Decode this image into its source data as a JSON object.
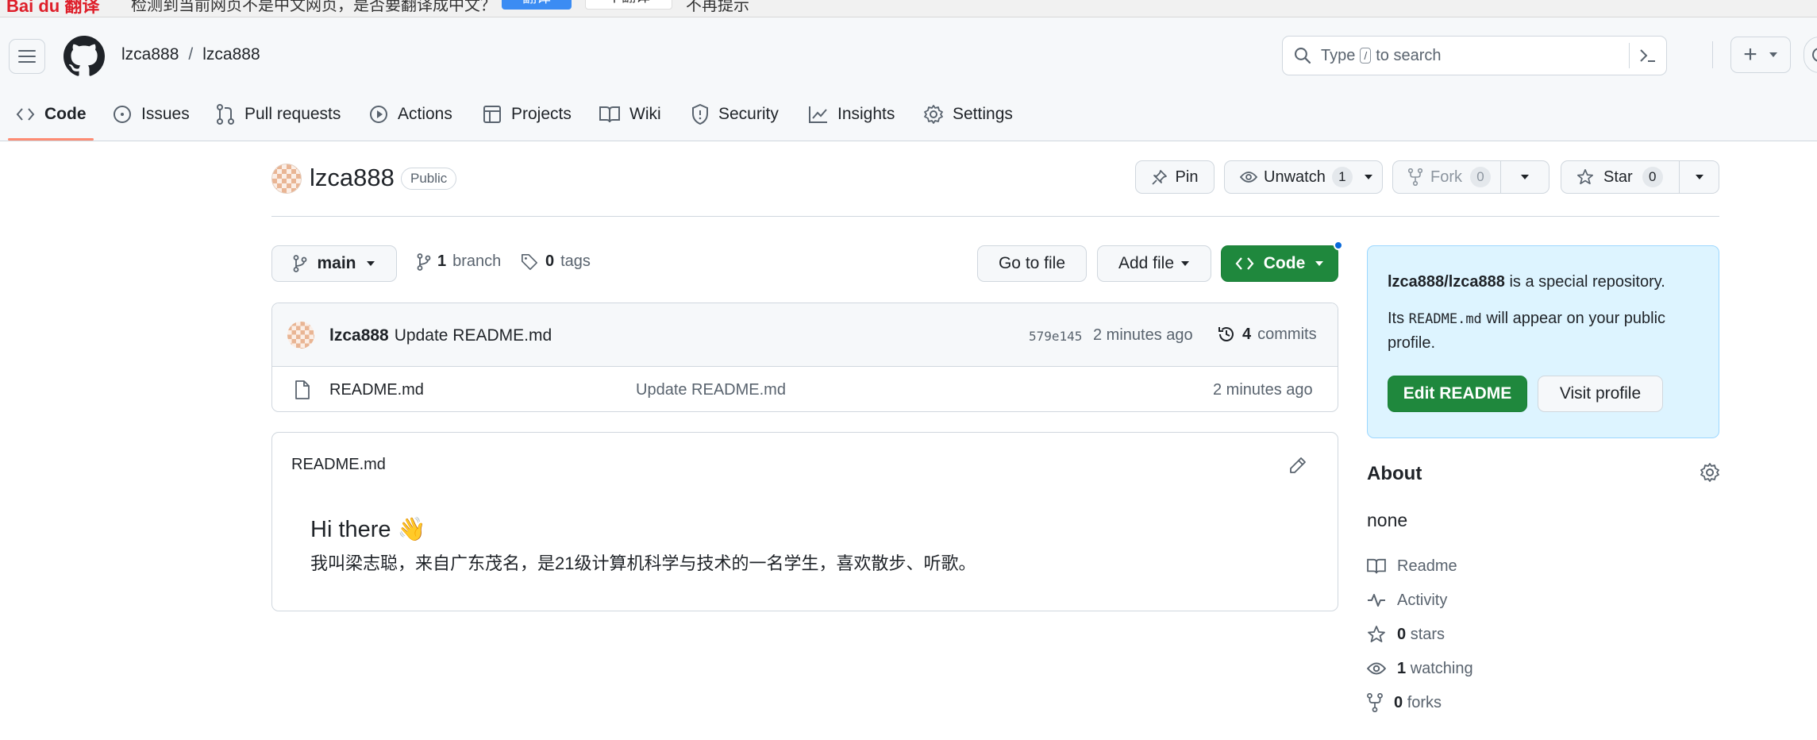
{
  "translate_bar": {
    "logo": "Bai du 翻译",
    "message": "检测到当前网页不是中文网页，是否要翻译成中文？",
    "translate_button": "翻译",
    "no_translate_button": "不翻译",
    "never_prompt": "不再提示"
  },
  "header": {
    "owner": "lzca888",
    "separator": "/",
    "repo": "lzca888",
    "search_prefix": "Type",
    "search_key": "/",
    "search_suffix": "to search",
    "plus": "+"
  },
  "tabs": [
    {
      "label": "Code",
      "icon": "code-icon"
    },
    {
      "label": "Issues",
      "icon": "issue-icon"
    },
    {
      "label": "Pull requests",
      "icon": "pull-request-icon"
    },
    {
      "label": "Actions",
      "icon": "play-icon"
    },
    {
      "label": "Projects",
      "icon": "table-icon"
    },
    {
      "label": "Wiki",
      "icon": "book-icon"
    },
    {
      "label": "Security",
      "icon": "shield-icon"
    },
    {
      "label": "Insights",
      "icon": "graph-icon"
    },
    {
      "label": "Settings",
      "icon": "gear-icon"
    }
  ],
  "repo": {
    "name": "lzca888",
    "visibility": "Public",
    "pin": "Pin",
    "unwatch": "Unwatch",
    "watch_count": "1",
    "fork": "Fork",
    "fork_count": "0",
    "star": "Star",
    "star_count": "0"
  },
  "toolbar": {
    "branch": "main",
    "branch_count": "1",
    "branch_label": "branch",
    "tag_count": "0",
    "tag_label": "tags",
    "go_to_file": "Go to file",
    "add_file": "Add file",
    "code": "Code"
  },
  "commit": {
    "author": "lzca888",
    "message": "Update README.md",
    "hash": "579e145",
    "time": "2 minutes ago",
    "count": "4",
    "count_label": "commits"
  },
  "files": [
    {
      "name": "README.md",
      "message": "Update README.md",
      "time": "2 minutes ago"
    }
  ],
  "readme": {
    "title": "README.md",
    "heading": "Hi there 👋",
    "body": "我叫梁志聪，来自广东茂名，是21级计算机科学与技术的一名学生，喜欢散步、听歌。"
  },
  "special": {
    "repo_ref": "lzca888/lzca888",
    "line1_rest": " is a special repository.",
    "line2_prefix": "Its ",
    "line2_code": "README.md",
    "line2_rest": " will appear on your public",
    "line3": "profile.",
    "edit_readme": "Edit README",
    "visit_profile": "Visit profile"
  },
  "about": {
    "title": "About",
    "description": "none",
    "items": [
      {
        "label": "Readme",
        "icon": "book-icon"
      },
      {
        "label": "Activity",
        "icon": "pulse-icon"
      },
      {
        "count": "0",
        "label": "stars",
        "icon": "star-icon"
      },
      {
        "count": "1",
        "label": "watching",
        "icon": "eye-icon"
      },
      {
        "count": "0",
        "label": "forks",
        "icon": "fork-icon"
      }
    ]
  },
  "colors": {
    "accent_green": "#1f883d",
    "tab_underline": "#fd8c73",
    "info_bg": "#ddf4ff"
  }
}
